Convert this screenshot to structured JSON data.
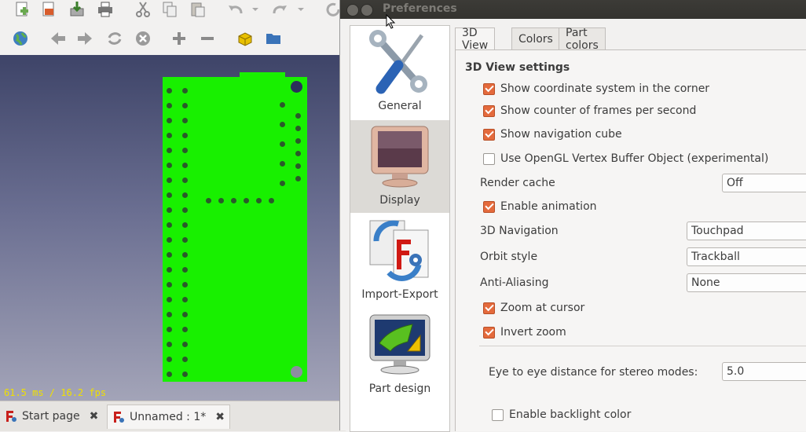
{
  "toolbar": {
    "row1": [
      "new-file-icon",
      "open-file-icon",
      "save-icon",
      "print-icon",
      "cut-icon",
      "copy-icon",
      "paste-icon",
      "undo-icon",
      "undo-dropdown-icon",
      "redo-icon",
      "redo-dropdown-icon",
      "refresh-icon"
    ],
    "row2": [
      "globe-icon",
      "back-arrow-icon",
      "forward-arrow-icon",
      "reload-icon",
      "stop-icon",
      "zoom-in-icon",
      "zoom-out-icon",
      "bookmark-icon",
      "folder-icon"
    ]
  },
  "viewport": {
    "fps": "61.5 ms / 16.2 fps",
    "board_color": "#18f000",
    "background_top": "#3e4468",
    "background_bottom": "#a3a4b8"
  },
  "doc_tabs": [
    {
      "label": "Start page"
    },
    {
      "label": "Unnamed : 1*"
    }
  ],
  "dialog": {
    "title": "Preferences",
    "categories": [
      {
        "label": "General",
        "icon": "wrench-screwdriver-icon"
      },
      {
        "label": "Display",
        "icon": "monitor-icon"
      },
      {
        "label": "Import-Export",
        "icon": "import-export-icon"
      },
      {
        "label": "Part design",
        "icon": "part-design-icon"
      }
    ],
    "tabs": [
      "3D View",
      "Colors",
      "Part colors"
    ],
    "section_title": "3D View settings",
    "checkboxes": {
      "coord_system": {
        "label": "Show coordinate system in the corner",
        "checked": true
      },
      "fps_counter": {
        "label": "Show counter of frames per second",
        "checked": true
      },
      "nav_cube": {
        "label": "Show navigation cube",
        "checked": true
      },
      "vbo": {
        "label": "Use OpenGL Vertex Buffer Object (experimental)",
        "checked": false
      },
      "animation": {
        "label": "Enable animation",
        "checked": true
      },
      "zoom_cursor": {
        "label": "Zoom at cursor",
        "checked": true
      },
      "invert_zoom": {
        "label": "Invert zoom",
        "checked": true
      },
      "backlight": {
        "label": "Enable backlight color",
        "checked": false
      }
    },
    "render_cache": {
      "label": "Render cache",
      "value": "Off"
    },
    "navigation": {
      "label": "3D Navigation",
      "value": "Touchpad"
    },
    "orbit_style": {
      "label": "Orbit style",
      "value": "Trackball"
    },
    "anti_aliasing": {
      "label": "Anti-Aliasing",
      "value": "None"
    },
    "eye_distance": {
      "label": "Eye to eye distance for stereo modes:",
      "value": "5.0"
    }
  }
}
